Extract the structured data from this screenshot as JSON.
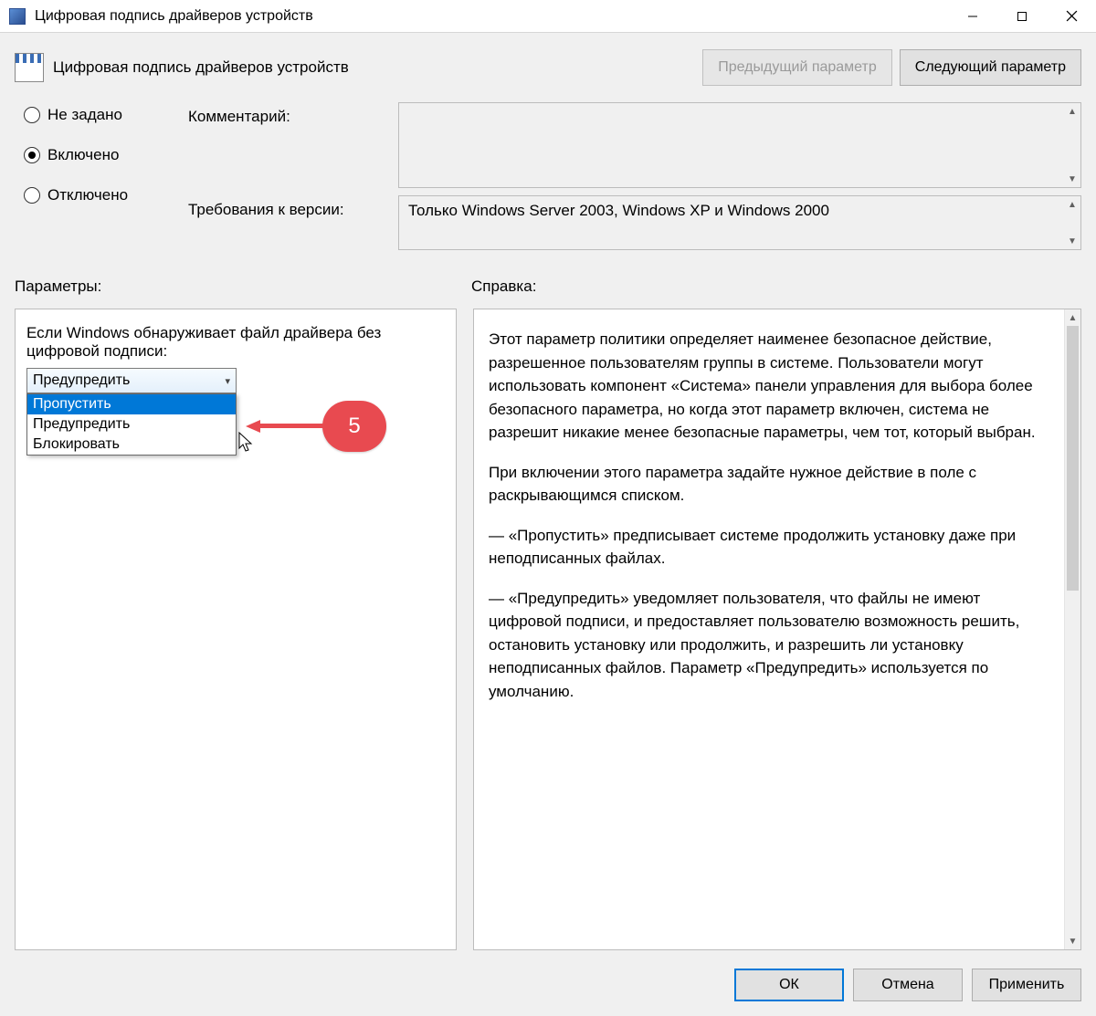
{
  "titlebar": {
    "title": "Цифровая подпись драйверов устройств"
  },
  "header": {
    "policy_name": "Цифровая подпись драйверов устройств",
    "prev_button": "Предыдущий параметр",
    "next_button": "Следующий параметр"
  },
  "state": {
    "not_configured": "Не задано",
    "enabled": "Включено",
    "disabled": "Отключено",
    "selected": "enabled"
  },
  "comment": {
    "label": "Комментарий:",
    "value": ""
  },
  "requirements": {
    "label": "Требования к версии:",
    "value": "Только Windows Server 2003, Windows XP и Windows 2000"
  },
  "sections": {
    "options_label": "Параметры:",
    "help_label": "Справка:"
  },
  "options": {
    "prompt": "Если Windows обнаруживает файл драйвера без цифровой подписи:",
    "combo_value": "Предупредить",
    "dropdown": {
      "items": [
        "Пропустить",
        "Предупредить",
        "Блокировать"
      ],
      "highlighted_index": 0
    }
  },
  "annotation": {
    "number": "5"
  },
  "help": {
    "p1": "Этот параметр политики определяет наименее безопасное действие, разрешенное пользователям группы в системе. Пользователи могут использовать компонент «Система» панели управления для выбора более безопасного параметра, но когда этот параметр включен, система не разрешит никакие менее безопасные параметры, чем тот, который выбран.",
    "p2": "При включении этого параметра задайте нужное действие в поле с раскрывающимся списком.",
    "p3": "— «Пропустить» предписывает системе продолжить установку даже при неподписанных файлах.",
    "p4": "— «Предупредить» уведомляет пользователя, что файлы не имеют цифровой подписи, и предоставляет пользователю возможность решить, остановить установку или продолжить, и разрешить ли установку неподписанных файлов. Параметр «Предупредить» используется по умолчанию."
  },
  "footer": {
    "ok": "ОК",
    "cancel": "Отмена",
    "apply": "Применить"
  }
}
